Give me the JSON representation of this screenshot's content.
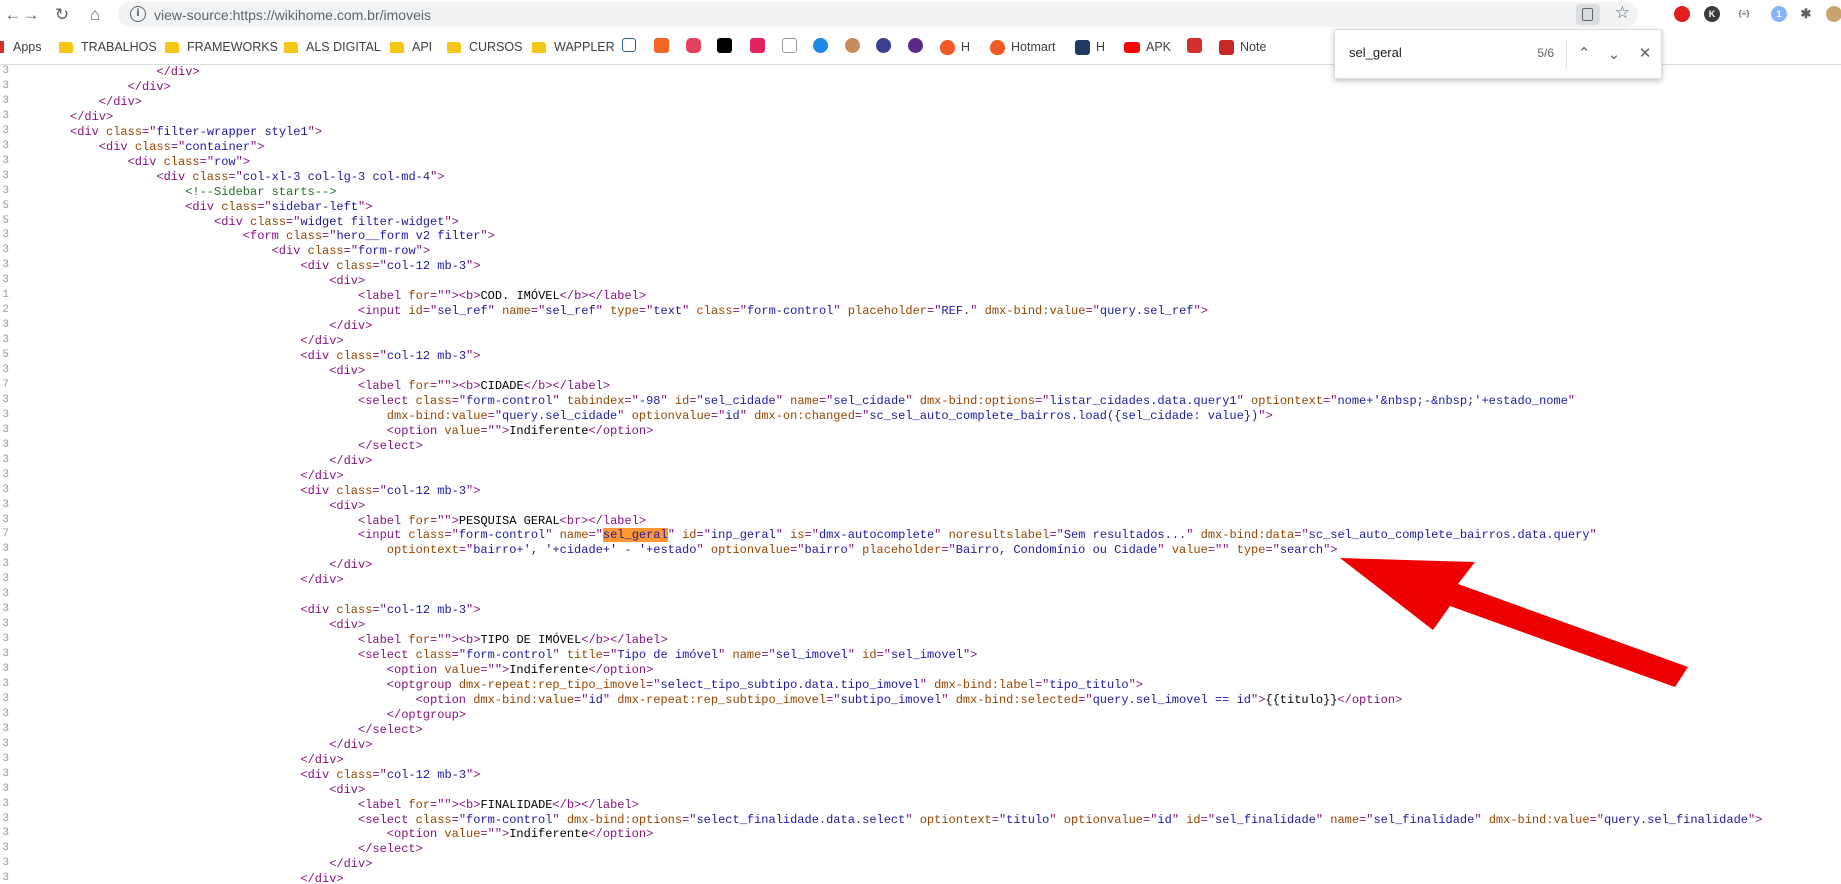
{
  "browser": {
    "url": "view-source:https://wikihome.com.br/imoveis",
    "bookmarks": [
      {
        "label": "Apps",
        "type": "apps"
      },
      {
        "label": "TRABALHOS",
        "type": "folder"
      },
      {
        "label": "FRAMEWORKS",
        "type": "folder"
      },
      {
        "label": "ALS DIGITAL",
        "type": "folder"
      },
      {
        "label": "API",
        "type": "folder"
      },
      {
        "label": "CURSOS",
        "type": "folder"
      },
      {
        "label": "WAPPLER",
        "type": "folder"
      },
      {
        "label": "H",
        "type": "site"
      },
      {
        "label": "Hotmart",
        "type": "site"
      },
      {
        "label": "H",
        "type": "site"
      },
      {
        "label": "APK",
        "type": "site"
      },
      {
        "label": "Note",
        "type": "site"
      }
    ],
    "find": {
      "query": "sel_geral",
      "count": "5/6"
    },
    "colors": {
      "arrow": "#ee0000",
      "highlight": "#ff9632",
      "tag": "#881280",
      "attr": "#994500",
      "value": "#1a1aa6",
      "comment": "#236e25"
    }
  },
  "source": {
    "lines": [
      {
        "n": "3",
        "indent": 6,
        "html": "<span class='tag'>&lt;/div&gt;</span>"
      },
      {
        "n": "3",
        "indent": 5,
        "html": "<span class='tag'>&lt;/div&gt;</span>"
      },
      {
        "n": "3",
        "indent": 4,
        "html": "<span class='tag'>&lt;/div&gt;</span>"
      },
      {
        "n": "3",
        "indent": 3,
        "html": "<span class='tag'>&lt;/div&gt;</span>"
      },
      {
        "n": "3",
        "indent": 3,
        "html": "<span class='tag'>&lt;div </span><span class='attr'>class</span><span class='tag'>=\"</span><span class='val'>filter-wrapper style1</span><span class='tag'>\"&gt;</span>"
      },
      {
        "n": "3",
        "indent": 4,
        "html": "<span class='tag'>&lt;div </span><span class='attr'>class</span><span class='tag'>=\"</span><span class='val'>container</span><span class='tag'>\"&gt;</span>"
      },
      {
        "n": "3",
        "indent": 5,
        "html": "<span class='tag'>&lt;div </span><span class='attr'>class</span><span class='tag'>=\"</span><span class='val'>row</span><span class='tag'>\"&gt;</span>"
      },
      {
        "n": "3",
        "indent": 6,
        "html": "<span class='tag'>&lt;div </span><span class='attr'>class</span><span class='tag'>=\"</span><span class='val'>col-xl-3 col-lg-3 col-md-4</span><span class='tag'>\"&gt;</span>"
      },
      {
        "n": "3",
        "indent": 7,
        "html": "<span class='cmt'>&lt;!--Sidebar starts--&gt;</span>"
      },
      {
        "n": "5",
        "indent": 7,
        "html": "<span class='tag'>&lt;div </span><span class='attr'>class</span><span class='tag'>=\"</span><span class='val'>sidebar-left</span><span class='tag'>\"&gt;</span>"
      },
      {
        "n": "5",
        "indent": 8,
        "html": "<span class='tag'>&lt;div </span><span class='attr'>class</span><span class='tag'>=\"</span><span class='val'>widget filter-widget</span><span class='tag'>\"&gt;</span>"
      },
      {
        "n": "3",
        "indent": 9,
        "html": "<span class='tag'>&lt;form </span><span class='attr'>class</span><span class='tag'>=\"</span><span class='val'>hero__form v2 filter</span><span class='tag'>\"&gt;</span>"
      },
      {
        "n": "3",
        "indent": 10,
        "html": "<span class='tag'>&lt;div </span><span class='attr'>class</span><span class='tag'>=\"</span><span class='val'>form-row</span><span class='tag'>\"&gt;</span>"
      },
      {
        "n": "3",
        "indent": 11,
        "html": "<span class='tag'>&lt;div </span><span class='attr'>class</span><span class='tag'>=\"</span><span class='val'>col-12 mb-3</span><span class='tag'>\"&gt;</span>"
      },
      {
        "n": "3",
        "indent": 12,
        "html": "<span class='tag'>&lt;div&gt;</span>"
      },
      {
        "n": "1",
        "indent": 13,
        "html": "<span class='tag'>&lt;label </span><span class='attr'>for</span><span class='tag'>=\"\"&gt;&lt;b&gt;</span>COD. IMÓVEL<span class='tag'>&lt;/b&gt;&lt;/label&gt;</span>"
      },
      {
        "n": "2",
        "indent": 13,
        "html": "<span class='tag'>&lt;input </span><span class='attr'>id</span><span class='tag'>=\"</span><span class='val'>sel_ref</span><span class='tag'>\" </span><span class='attr'>name</span><span class='tag'>=\"</span><span class='val'>sel_ref</span><span class='tag'>\" </span><span class='attr'>type</span><span class='tag'>=\"</span><span class='val'>text</span><span class='tag'>\" </span><span class='attr'>class</span><span class='tag'>=\"</span><span class='val'>form-control</span><span class='tag'>\" </span><span class='attr'>placeholder</span><span class='tag'>=\"</span><span class='val'>REF.</span><span class='tag'>\" </span><span class='attr'>dmx-bind:value</span><span class='tag'>=\"</span><span class='val'>query.sel_ref</span><span class='tag'>\"&gt;</span>"
      },
      {
        "n": "3",
        "indent": 12,
        "html": "<span class='tag'>&lt;/div&gt;</span>"
      },
      {
        "n": "3",
        "indent": 11,
        "html": "<span class='tag'>&lt;/div&gt;</span>"
      },
      {
        "n": "5",
        "indent": 11,
        "html": "<span class='tag'>&lt;div </span><span class='attr'>class</span><span class='tag'>=\"</span><span class='val'>col-12 mb-3</span><span class='tag'>\"&gt;</span>"
      },
      {
        "n": "3",
        "indent": 12,
        "html": "<span class='tag'>&lt;div&gt;</span>"
      },
      {
        "n": "7",
        "indent": 13,
        "html": "<span class='tag'>&lt;label </span><span class='attr'>for</span><span class='tag'>=\"\"&gt;&lt;b&gt;</span>CIDADE<span class='tag'>&lt;/b&gt;&lt;/label&gt;</span>"
      },
      {
        "n": "3",
        "indent": 13,
        "html": "<span class='tag'>&lt;select </span><span class='attr'>class</span><span class='tag'>=\"</span><span class='val'>form-control</span><span class='tag'>\" </span><span class='attr'>tabindex</span><span class='tag'>=\"</span><span class='val'>-98</span><span class='tag'>\" </span><span class='attr'>id</span><span class='tag'>=\"</span><span class='val'>sel_cidade</span><span class='tag'>\" </span><span class='attr'>name</span><span class='tag'>=\"</span><span class='val'>sel_cidade</span><span class='tag'>\" </span><span class='attr'>dmx-bind:options</span><span class='tag'>=\"</span><span class='val'>listar_cidades.data.query1</span><span class='tag'>\" </span><span class='attr'>optiontext</span><span class='tag'>=\"</span><span class='val'>nome+'&amp;nbsp;-&amp;nbsp;'+estado_nome</span><span class='tag'>\"</span>"
      },
      {
        "n": "3",
        "indent": 14,
        "html": "<span class='attr'>dmx-bind:value</span><span class='tag'>=\"</span><span class='val'>query.sel_cidade</span><span class='tag'>\" </span><span class='attr'>optionvalue</span><span class='tag'>=\"</span><span class='val'>id</span><span class='tag'>\" </span><span class='attr'>dmx-on:changed</span><span class='tag'>=\"</span><span class='val'>sc_sel_auto_complete_bairros.load({sel_cidade: value})</span><span class='tag'>\"&gt;</span>"
      },
      {
        "n": "3",
        "indent": 14,
        "html": "<span class='tag'>&lt;option </span><span class='attr'>value</span><span class='tag'>=\"\"&gt;</span>Indiferente<span class='tag'>&lt;/option&gt;</span>"
      },
      {
        "n": "3",
        "indent": 13,
        "html": "<span class='tag'>&lt;/select&gt;</span>"
      },
      {
        "n": "3",
        "indent": 12,
        "html": "<span class='tag'>&lt;/div&gt;</span>"
      },
      {
        "n": "3",
        "indent": 11,
        "html": "<span class='tag'>&lt;/div&gt;</span>"
      },
      {
        "n": "3",
        "indent": 11,
        "html": "<span class='tag'>&lt;div </span><span class='attr'>class</span><span class='tag'>=\"</span><span class='val'>col-12 mb-3</span><span class='tag'>\"&gt;</span>"
      },
      {
        "n": "3",
        "indent": 12,
        "html": "<span class='tag'>&lt;div&gt;</span>"
      },
      {
        "n": "3",
        "indent": 13,
        "html": "<span class='tag'>&lt;label </span><span class='attr'>for</span><span class='tag'>=\"\"&gt;</span>PESQUISA GERAL<span class='tag'>&lt;br&gt;&lt;/label&gt;</span>"
      },
      {
        "n": "7",
        "indent": 13,
        "html": "<span class='tag'>&lt;input </span><span class='attr'>class</span><span class='tag'>=\"</span><span class='val'>form-control</span><span class='tag'>\" </span><span class='attr'>name</span><span class='tag'>=\"</span><span class='val hl'>sel_geral</span><span class='tag'>\" </span><span class='attr'>id</span><span class='tag'>=\"</span><span class='val'>inp_geral</span><span class='tag'>\" </span><span class='attr'>is</span><span class='tag'>=\"</span><span class='val'>dmx-autocomplete</span><span class='tag'>\" </span><span class='attr'>noresultslabel</span><span class='tag'>=\"</span><span class='val'>Sem resultados...</span><span class='tag'>\" </span><span class='attr'>dmx-bind:data</span><span class='tag'>=\"</span><span class='val'>sc_sel_auto_complete_bairros.data.query</span><span class='tag'>\"</span>"
      },
      {
        "n": "3",
        "indent": 14,
        "html": "<span class='attr'>optiontext</span><span class='tag'>=\"</span><span class='val'>bairro+', '+cidade+' - '+estado</span><span class='tag'>\" </span><span class='attr'>optionvalue</span><span class='tag'>=\"</span><span class='val'>bairro</span><span class='tag'>\" </span><span class='attr'>placeholder</span><span class='tag'>=\"</span><span class='val'>Bairro, Condomínio ou Cidade</span><span class='tag'>\" </span><span class='attr'>value</span><span class='tag'>=\"\" </span><span class='attr'>type</span><span class='tag'>=\"</span><span class='val'>search</span><span class='tag'>\"&gt;</span>"
      },
      {
        "n": "3",
        "indent": 12,
        "html": "<span class='tag'>&lt;/div&gt;</span>"
      },
      {
        "n": "3",
        "indent": 11,
        "html": "<span class='tag'>&lt;/div&gt;</span>"
      },
      {
        "n": "3",
        "indent": 0,
        "html": ""
      },
      {
        "n": "3",
        "indent": 11,
        "html": "<span class='tag'>&lt;div </span><span class='attr'>class</span><span class='tag'>=\"</span><span class='val'>col-12 mb-3</span><span class='tag'>\"&gt;</span>"
      },
      {
        "n": "3",
        "indent": 12,
        "html": "<span class='tag'>&lt;div&gt;</span>"
      },
      {
        "n": "3",
        "indent": 13,
        "html": "<span class='tag'>&lt;label </span><span class='attr'>for</span><span class='tag'>=\"\"&gt;&lt;b&gt;</span>TIPO DE IMÓVEL<span class='tag'>&lt;/b&gt;&lt;/label&gt;</span>"
      },
      {
        "n": "3",
        "indent": 13,
        "html": "<span class='tag'>&lt;select </span><span class='attr'>class</span><span class='tag'>=\"</span><span class='val'>form-control</span><span class='tag'>\" </span><span class='attr'>title</span><span class='tag'>=\"</span><span class='val'>Tipo de imóvel</span><span class='tag'>\" </span><span class='attr'>name</span><span class='tag'>=\"</span><span class='val'>sel_imovel</span><span class='tag'>\" </span><span class='attr'>id</span><span class='tag'>=\"</span><span class='val'>sel_imovel</span><span class='tag'>\"&gt;</span>"
      },
      {
        "n": "3",
        "indent": 14,
        "html": "<span class='tag'>&lt;option </span><span class='attr'>value</span><span class='tag'>=\"\"&gt;</span>Indiferente<span class='tag'>&lt;/option&gt;</span>"
      },
      {
        "n": "3",
        "indent": 14,
        "html": "<span class='tag'>&lt;optgroup </span><span class='attr'>dmx-repeat:rep_tipo_imovel</span><span class='tag'>=\"</span><span class='val'>select_tipo_subtipo.data.tipo_imovel</span><span class='tag'>\" </span><span class='attr'>dmx-bind:label</span><span class='tag'>=\"</span><span class='val'>tipo_titulo</span><span class='tag'>\"&gt;</span>"
      },
      {
        "n": "3",
        "indent": 15,
        "html": "<span class='tag'>&lt;option </span><span class='attr'>dmx-bind:value</span><span class='tag'>=\"</span><span class='val'>id</span><span class='tag'>\" </span><span class='attr'>dmx-repeat:rep_subtipo_imovel</span><span class='tag'>=\"</span><span class='val'>subtipo_imovel</span><span class='tag'>\" </span><span class='attr'>dmx-bind:selected</span><span class='tag'>=\"</span><span class='val'>query.sel_imovel == id</span><span class='tag'>\"&gt;</span>{{titulo}}<span class='tag'>&lt;/option&gt;</span>"
      },
      {
        "n": "3",
        "indent": 14,
        "html": "<span class='tag'>&lt;/optgroup&gt;</span>"
      },
      {
        "n": "3",
        "indent": 13,
        "html": "<span class='tag'>&lt;/select&gt;</span>"
      },
      {
        "n": "3",
        "indent": 12,
        "html": "<span class='tag'>&lt;/div&gt;</span>"
      },
      {
        "n": "3",
        "indent": 11,
        "html": "<span class='tag'>&lt;/div&gt;</span>"
      },
      {
        "n": "3",
        "indent": 11,
        "html": "<span class='tag'>&lt;div </span><span class='attr'>class</span><span class='tag'>=\"</span><span class='val'>col-12 mb-3</span><span class='tag'>\"&gt;</span>"
      },
      {
        "n": "3",
        "indent": 12,
        "html": "<span class='tag'>&lt;div&gt;</span>"
      },
      {
        "n": "3",
        "indent": 13,
        "html": "<span class='tag'>&lt;label </span><span class='attr'>for</span><span class='tag'>=\"\"&gt;&lt;b&gt;</span>FINALIDADE<span class='tag'>&lt;/b&gt;&lt;/label&gt;</span>"
      },
      {
        "n": "3",
        "indent": 13,
        "html": "<span class='tag'>&lt;select </span><span class='attr'>class</span><span class='tag'>=\"</span><span class='val'>form-control</span><span class='tag'>\" </span><span class='attr'>dmx-bind:options</span><span class='tag'>=\"</span><span class='val'>select_finalidade.data.select</span><span class='tag'>\" </span><span class='attr'>optiontext</span><span class='tag'>=\"</span><span class='val'>titulo</span><span class='tag'>\" </span><span class='attr'>optionvalue</span><span class='tag'>=\"</span><span class='val'>id</span><span class='tag'>\" </span><span class='attr'>id</span><span class='tag'>=\"</span><span class='val'>sel_finalidade</span><span class='tag'>\" </span><span class='attr'>name</span><span class='tag'>=\"</span><span class='val'>sel_finalidade</span><span class='tag'>\" </span><span class='attr'>dmx-bind:value</span><span class='tag'>=\"</span><span class='val'>query.sel_finalidade</span><span class='tag'>\"&gt;</span>"
      },
      {
        "n": "3",
        "indent": 14,
        "html": "<span class='tag'>&lt;option </span><span class='attr'>value</span><span class='tag'>=\"\"&gt;</span>Indiferente<span class='tag'>&lt;/option&gt;</span>"
      },
      {
        "n": "3",
        "indent": 13,
        "html": "<span class='tag'>&lt;/select&gt;</span>"
      },
      {
        "n": "3",
        "indent": 12,
        "html": "<span class='tag'>&lt;/div&gt;</span>"
      },
      {
        "n": "3",
        "indent": 11,
        "html": "<span class='tag'>&lt;/div&gt;</span>"
      }
    ]
  }
}
